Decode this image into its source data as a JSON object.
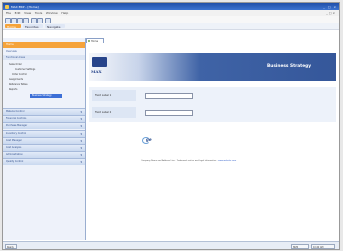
{
  "window": {
    "title": "MAX ERP - [Home]",
    "controls": "_ □ ×"
  },
  "menu": {
    "items": [
      "File",
      "Edit",
      "View",
      "Tools",
      "Window",
      "Help"
    ],
    "right": "_ □ ×"
  },
  "navbar": {
    "home_label": "Home",
    "item1": "Favorites",
    "item2": "Navigate"
  },
  "sidebar": {
    "header": "Home",
    "rows": [
      "Overview",
      "Functional Areas"
    ],
    "tree": [
      "Sales Order",
      "Customer Settings",
      "Order Control",
      "Assignments",
      "Reference Tables",
      "Reports"
    ],
    "selected": "Business Strategy",
    "collapsed": [
      "Material Control",
      "Financial Controls",
      "Purchase Manager",
      "Inventory Control",
      "Cost Manager",
      "Cost Analysis",
      "Administration",
      "Quality Control"
    ]
  },
  "main": {
    "tab_label": "Home",
    "logo_text": "MAX",
    "banner_title": "Business Strategy",
    "fields": [
      {
        "label": "Field Label 1",
        "value": ""
      },
      {
        "label": "Field Label 2",
        "value": ""
      }
    ],
    "mini_logo_text": "ge",
    "footer_text": "Company Name and Address Line · Trademark notice and legal information ·",
    "footer_link": "www.website.com"
  },
  "status": {
    "left": "Ready",
    "right1": "NUM",
    "right2": "10:42 AM"
  },
  "colors": {
    "accent": "#f5a33a",
    "brand": "#27448a"
  }
}
